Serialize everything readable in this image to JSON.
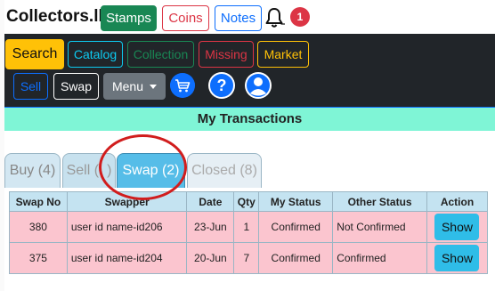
{
  "header": {
    "brand": "Collectors.lk",
    "stamps": "Stamps",
    "coins": "Coins",
    "notes": "Notes",
    "badge": "1"
  },
  "nav": {
    "search": "Search",
    "catalog": "Catalog",
    "collection": "Collection",
    "missing": "Missing",
    "market": "Market",
    "sell": "Sell",
    "swap": "Swap",
    "menu": "Menu"
  },
  "page": {
    "title": "My Transactions"
  },
  "tabs": [
    {
      "label": "Buy (4)"
    },
    {
      "label": "Sell (",
      "tail": ")"
    },
    {
      "label": "Swap (2)"
    },
    {
      "label": "Closed (8)"
    }
  ],
  "table": {
    "headers": [
      "Swap No",
      "Swapper",
      "Date",
      "Qty",
      "My Status",
      "Other Status",
      "Action"
    ],
    "rows": [
      {
        "swap_no": "380",
        "swapper": "user id name-id206",
        "date": "23-Jun",
        "qty": "1",
        "my_status": "Confirmed",
        "other_status": "Not Confirmed",
        "action": "Show"
      },
      {
        "swap_no": "375",
        "swapper": "user id name-id204",
        "date": "20-Jun",
        "qty": "7",
        "my_status": "Confirmed",
        "other_status": "Confirmed",
        "action": "Show"
      }
    ]
  },
  "icons": {
    "bell": "bell-icon",
    "cart": "cart-icon",
    "help": "help-icon",
    "user": "user-icon",
    "caret": "caret-down-icon"
  },
  "colors": {
    "dark_nav": "#212529",
    "title_band": "#7ff5d6",
    "active_tab": "#56bde8",
    "row_bg": "#fbc5cf",
    "header_bg": "#c4e3f1",
    "annotation_circle": "#d11d1d"
  }
}
